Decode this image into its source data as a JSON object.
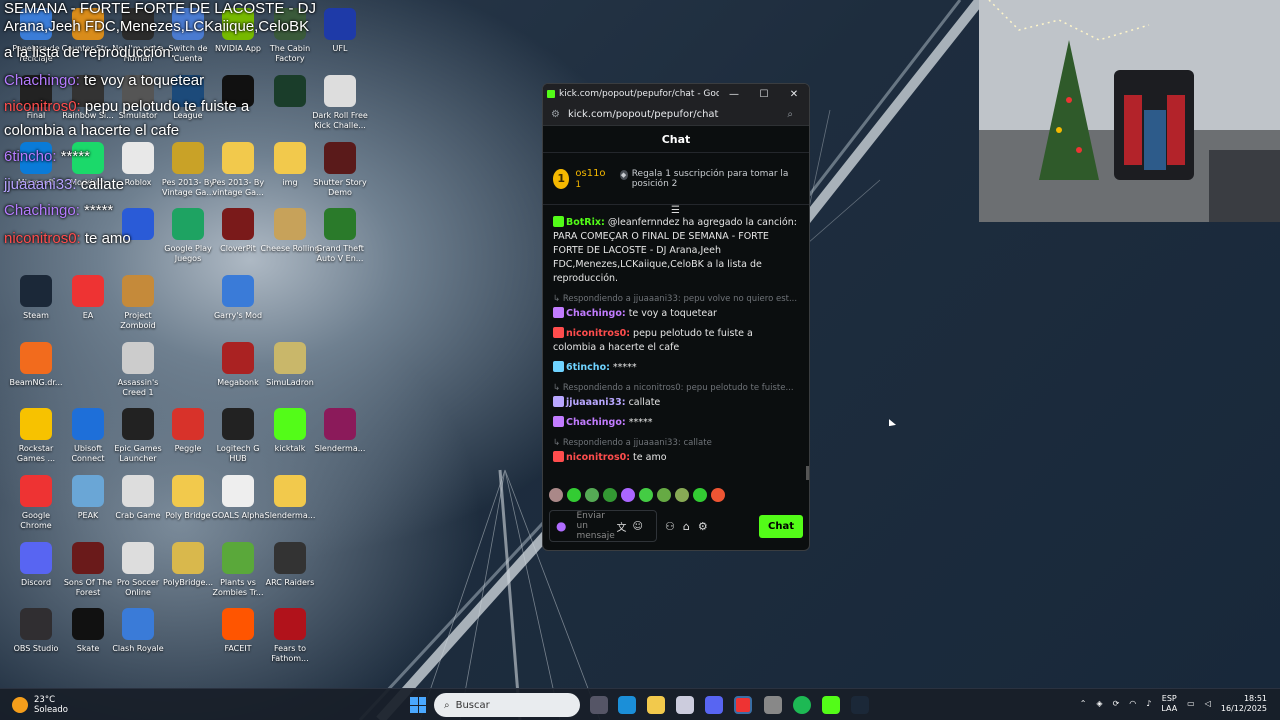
{
  "desktop_icons": [
    {
      "label": "Papelera de reciclaje",
      "color": "#3b7dd8",
      "glyph": "recycle-bin-icon"
    },
    {
      "label": "Counter-Str...",
      "color": "#d98c1a",
      "glyph": "cs-icon"
    },
    {
      "label": "No, I'm not a Human",
      "color": "#2b2b2b",
      "glyph": "game-icon"
    },
    {
      "label": "Switch de Cuenta",
      "color": "#4a7bd1",
      "glyph": "switch-icon"
    },
    {
      "label": "NVIDIA App",
      "color": "#76b900",
      "glyph": "nvidia-icon"
    },
    {
      "label": "The Cabin Factory",
      "color": "#3a5a3a",
      "glyph": "game-icon"
    },
    {
      "label": "UFL",
      "color": "#1e3aa8",
      "glyph": "ufl-icon"
    },
    {
      "label": "Final",
      "color": "#222",
      "glyph": "game-icon"
    },
    {
      "label": "Rainbow Si...",
      "color": "#333",
      "glyph": "game-icon"
    },
    {
      "label": "Simulator",
      "color": "#555",
      "glyph": "game-icon"
    },
    {
      "label": "League",
      "color": "#1c4a7a",
      "glyph": "game-icon"
    },
    {
      "label": "",
      "color": "#111",
      "glyph": "notion-icon"
    },
    {
      "label": "",
      "color": "#1a3d2a",
      "glyph": "game-icon"
    },
    {
      "label": "Dark Roll Free Kick Challe...",
      "color": "#ddd",
      "glyph": "ball-icon"
    },
    {
      "label": "Microsoft",
      "color": "#0a7bd8",
      "glyph": "edge-icon"
    },
    {
      "label": "Modrinth",
      "color": "#1bd96a",
      "glyph": "modrinth-icon"
    },
    {
      "label": "Roblox",
      "color": "#e8e8e8",
      "glyph": "roblox-icon"
    },
    {
      "label": "Pes 2013- By Vintage Ga...",
      "color": "#c9a227",
      "glyph": "folder-icon"
    },
    {
      "label": "Pes 2013- By vintage Ga...",
      "color": "#f2c94c",
      "glyph": "folder-icon"
    },
    {
      "label": "img",
      "color": "#f2c94c",
      "glyph": "folder-icon"
    },
    {
      "label": "Shutter Story Demo",
      "color": "#5a1a1a",
      "glyph": "game-icon"
    },
    {
      "label": "",
      "color": "#2a5bd7",
      "glyph": "roblox-icon"
    },
    {
      "label": "Google Play Juegos",
      "color": "#1ea362",
      "glyph": "play-icon"
    },
    {
      "label": "CloverPit",
      "color": "#7a1a1a",
      "glyph": "game-icon"
    },
    {
      "label": "Cheese Rolling",
      "color": "#c7a25a",
      "glyph": "game-icon"
    },
    {
      "label": "Grand Theft Auto V En...",
      "color": "#2a7a2a",
      "glyph": "gta-icon"
    },
    {
      "label": "Steam",
      "color": "#1b2838",
      "glyph": "steam-icon"
    },
    {
      "label": "EA",
      "color": "#e33",
      "glyph": "ea-icon"
    },
    {
      "label": "Project Zomboid",
      "color": "#c58a3a",
      "glyph": "game-icon"
    },
    {
      "label": "Garry's Mod",
      "color": "#3a7bd8",
      "glyph": "gmod-icon"
    },
    {
      "label": "BeamNG.dr...",
      "color": "#f26b1d",
      "glyph": "beamng-icon"
    },
    {
      "label": "Assassin's Creed 1",
      "color": "#ccc",
      "glyph": "ac-icon"
    },
    {
      "label": "Megabonk",
      "color": "#a22",
      "glyph": "game-icon"
    },
    {
      "label": "SimuLadron",
      "color": "#c9b76a",
      "glyph": "game-icon"
    },
    {
      "label": "Rockstar Games ...",
      "color": "#f7c200",
      "glyph": "rockstar-icon"
    },
    {
      "label": "Ubisoft Connect",
      "color": "#1e6fd9",
      "glyph": "ubisoft-icon"
    },
    {
      "label": "Epic Games Launcher",
      "color": "#222",
      "glyph": "epic-icon"
    },
    {
      "label": "Peggle",
      "color": "#d8322a",
      "glyph": "game-icon"
    },
    {
      "label": "Logitech G HUB",
      "color": "#222",
      "glyph": "logitech-icon"
    },
    {
      "label": "kicktalk",
      "color": "#53fc18",
      "glyph": "kick-icon"
    },
    {
      "label": "Slenderma...",
      "color": "#8b1a5a",
      "glyph": "winrar-icon"
    },
    {
      "label": "Google Chrome",
      "color": "#e33",
      "glyph": "chrome-icon"
    },
    {
      "label": "PEAK",
      "color": "#6aa6d6",
      "glyph": "game-icon"
    },
    {
      "label": "Crab Game",
      "color": "#ddd",
      "glyph": "game-icon"
    },
    {
      "label": "Poly Bridge",
      "color": "#f2c94c",
      "glyph": "game-icon"
    },
    {
      "label": "GOALS Alpha",
      "color": "#eee",
      "glyph": "game-icon"
    },
    {
      "label": "Slenderma...",
      "color": "#f2c94c",
      "glyph": "folder-icon"
    },
    {
      "label": "Discord",
      "color": "#5865f2",
      "glyph": "discord-icon"
    },
    {
      "label": "Sons Of The Forest",
      "color": "#6a1a1a",
      "glyph": "game-icon"
    },
    {
      "label": "Pro Soccer Online",
      "color": "#ddd",
      "glyph": "ball-icon"
    },
    {
      "label": "PolyBridge...",
      "color": "#d9b84c",
      "glyph": "folder-icon"
    },
    {
      "label": "Plants vs Zombies Tr...",
      "color": "#5aa83a",
      "glyph": "game-icon"
    },
    {
      "label": "ARC Raiders",
      "color": "#333",
      "glyph": "game-icon"
    },
    {
      "label": "OBS Studio",
      "color": "#302e31",
      "glyph": "obs-icon"
    },
    {
      "label": "Skate",
      "color": "#111",
      "glyph": "skate-icon"
    },
    {
      "label": "Clash Royale",
      "color": "#3a7bd8",
      "glyph": "game-icon"
    },
    {
      "label": "FACEIT",
      "color": "#ff5500",
      "glyph": "faceit-icon"
    },
    {
      "label": "Fears to Fathom...",
      "color": "#b1121b",
      "glyph": "f2f-icon"
    }
  ],
  "overlay": [
    {
      "name": "",
      "text": "SEMANA - FORTE FORTE DE LACOSTE - DJ"
    },
    {
      "name": "",
      "text": "Arana,Jeeh FDC,Menezes,LCKaiique,CeloBK"
    },
    {
      "name": "",
      "text": "a la lista de reproducción."
    },
    {
      "name": "Chachingo:",
      "text": " te voy a toquetear"
    },
    {
      "name": "niconitros0:",
      "text": " pepu pelotudo te fuiste a"
    },
    {
      "name": "",
      "text": "colombia a hacerte el cafe"
    },
    {
      "name": "6tincho:",
      "text": " *****"
    },
    {
      "name": "jjuaaani33:",
      "text": " callate"
    },
    {
      "name": "Chachingo:",
      "text": " *****"
    },
    {
      "name": "niconitros0:",
      "text": " te amo"
    }
  ],
  "browser": {
    "title": "kick.com/popout/pepufor/chat - Google Ch...",
    "url": "kick.com/popout/pepufor/chat",
    "min": "—",
    "max": "☐",
    "close": "✕"
  },
  "chat": {
    "header": "Chat",
    "pinned": {
      "rank": "1",
      "name": "os11o",
      "count": "1",
      "gift": "Regala 1 suscripción para tomar la posición 2"
    },
    "messages": [
      {
        "reply": "",
        "name": "BotRix:",
        "name_color": "#53fc18",
        "text": " @leanfernndez ha agregado la canción: PARA COMEÇAR O FINAL DE SEMANA - FORTE FORTE DE LACOSTE - DJ Arana,Jeeh FDC,Menezes,LCKaiique,CeloBK a la lista de reproducción."
      },
      {
        "reply": "↳ Respondiendo a jjuaaani33: pepu volve no quiero est...",
        "name": "Chachingo:",
        "name_color": "#c27cff",
        "text": " te voy a toquetear"
      },
      {
        "reply": "",
        "name": "niconitros0:",
        "name_color": "#ff4d4d",
        "text": " pepu pelotudo te fuiste a colombia a hacerte el cafe"
      },
      {
        "reply": "",
        "name": "6tincho:",
        "name_color": "#6fd3ff",
        "text": " *****"
      },
      {
        "reply": "↳ Respondiendo a niconitros0: pepu pelotudo te fuiste...",
        "name": "jjuaaani33:",
        "name_color": "#b9a7ff",
        "text": " callate"
      },
      {
        "reply": "",
        "name": "Chachingo:",
        "name_color": "#c27cff",
        "text": " *****"
      },
      {
        "reply": "↳ Respondiendo a jjuaaani33: callate",
        "name": "niconitros0:",
        "name_color": "#ff4d4d",
        "text": " te amo"
      }
    ],
    "input_placeholder": "Enviar un mensaje",
    "send_label": "Chat"
  },
  "taskbar": {
    "temp": "23°C",
    "weather": "Soleado",
    "search_placeholder": "Buscar",
    "lang1": "ESP",
    "lang2": "LAA",
    "time": "18:51",
    "date": "16/12/2025"
  },
  "colors": {
    "kick_green": "#53fc18",
    "gold": "#f5b800"
  }
}
